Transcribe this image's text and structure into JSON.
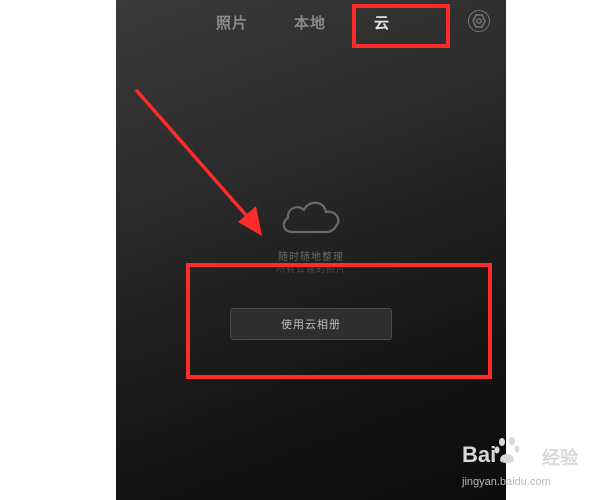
{
  "tabs": {
    "photos": "照片",
    "local": "本地",
    "cloud": "云"
  },
  "active_tab": "cloud",
  "icons": {
    "settings": "settings-icon",
    "cloud": "cloud-icon"
  },
  "empty_state": {
    "line1": "随时随地整理",
    "line2": "所有云端的照片"
  },
  "button": {
    "use_cloud_album": "使用云相册"
  },
  "annotation": {
    "color": "#ff2a2a"
  },
  "watermark": {
    "logo": "Bai",
    "brand": "经验",
    "url": "jingyan.baidu.com"
  }
}
